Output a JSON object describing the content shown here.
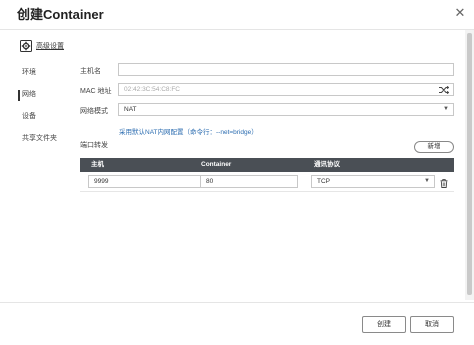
{
  "dialog": {
    "title": "创建Container"
  },
  "advanced": {
    "label": "高级设置"
  },
  "sidebar": {
    "items": [
      {
        "label": "环境"
      },
      {
        "label": "网络"
      },
      {
        "label": "设备"
      },
      {
        "label": "共享文件夹"
      }
    ]
  },
  "network": {
    "hostname_label": "主机名",
    "hostname_value": "",
    "mac_label": "MAC 地址",
    "mac_placeholder": "02:42:3C:54:C8:FC",
    "mode_label": "网络模式",
    "mode_value": "NAT",
    "nat_note": "采用默认NAT内网配置（命令行：--net=bridge）"
  },
  "port_forward": {
    "label": "端口转发",
    "add_label": "新增",
    "columns": [
      "主机",
      "Container",
      "通讯协议"
    ],
    "rows": [
      {
        "host": "9999",
        "container": "80",
        "protocol": "TCP"
      }
    ]
  },
  "footer": {
    "create_label": "创建",
    "cancel_label": "取消"
  }
}
